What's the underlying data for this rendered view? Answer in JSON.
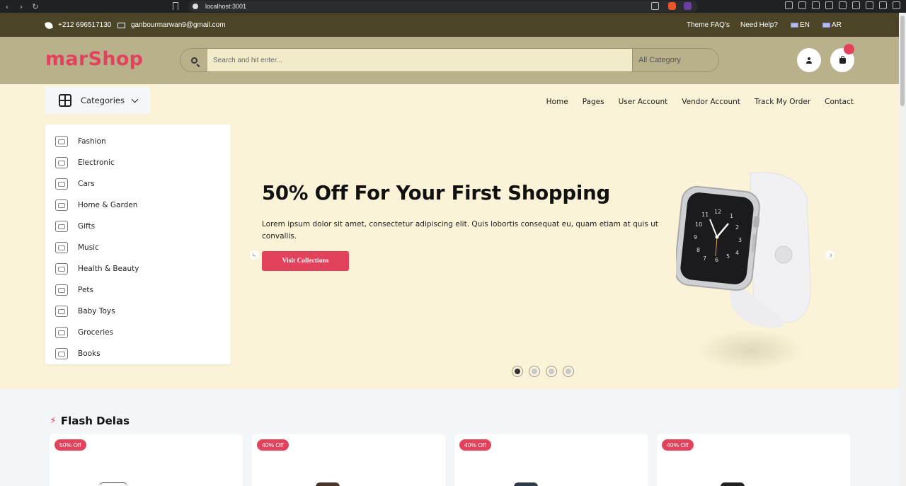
{
  "browser": {
    "url": "localhost:3001"
  },
  "topbar": {
    "phone": "+212 696517130",
    "email": "ganbourmarwan9@gmail.com",
    "faq": "Theme FAQ's",
    "help": "Need Help?",
    "lang_en": "EN",
    "lang_ar": "AR"
  },
  "header": {
    "logo": "marShop",
    "search_placeholder": "Search and hit enter...",
    "category_select": "All Category"
  },
  "nav": {
    "categories_label": "Categories",
    "links": [
      "Home",
      "Pages",
      "User Account",
      "Vendor Account",
      "Track My Order",
      "Contact"
    ]
  },
  "sidebar": {
    "items": [
      {
        "label": "Fashion",
        "icon": "fashion-icon"
      },
      {
        "label": "Electronic",
        "icon": "electronic-icon"
      },
      {
        "label": "Cars",
        "icon": "car-icon"
      },
      {
        "label": "Home & Garden",
        "icon": "home-garden-icon"
      },
      {
        "label": "Gifts",
        "icon": "gift-icon"
      },
      {
        "label": "Music",
        "icon": "music-icon"
      },
      {
        "label": "Health & Beauty",
        "icon": "health-beauty-icon"
      },
      {
        "label": "Pets",
        "icon": "pet-icon"
      },
      {
        "label": "Baby Toys",
        "icon": "baby-toys-icon"
      },
      {
        "label": "Groceries",
        "icon": "groceries-icon"
      },
      {
        "label": "Books",
        "icon": "books-icon"
      }
    ]
  },
  "hero": {
    "title": "50% Off For Your First Shopping",
    "text": "Lorem ipsum dolor sit amet, consectetur adipiscing elit. Quis lobortis consequat eu, quam etiam at quis ut convallis.",
    "button": "Visit Collections",
    "active_slide": 1,
    "slide_count": 4
  },
  "flash": {
    "title": "Flash Delas",
    "cards": [
      {
        "badge": "50% Off"
      },
      {
        "badge": "40% Off"
      },
      {
        "badge": "40% Off"
      },
      {
        "badge": "40% Off"
      }
    ]
  },
  "colors": {
    "accent": "#e3425c",
    "topbar": "#4b4427",
    "header": "#b9b18b",
    "hero_bg": "#faf3d7"
  }
}
